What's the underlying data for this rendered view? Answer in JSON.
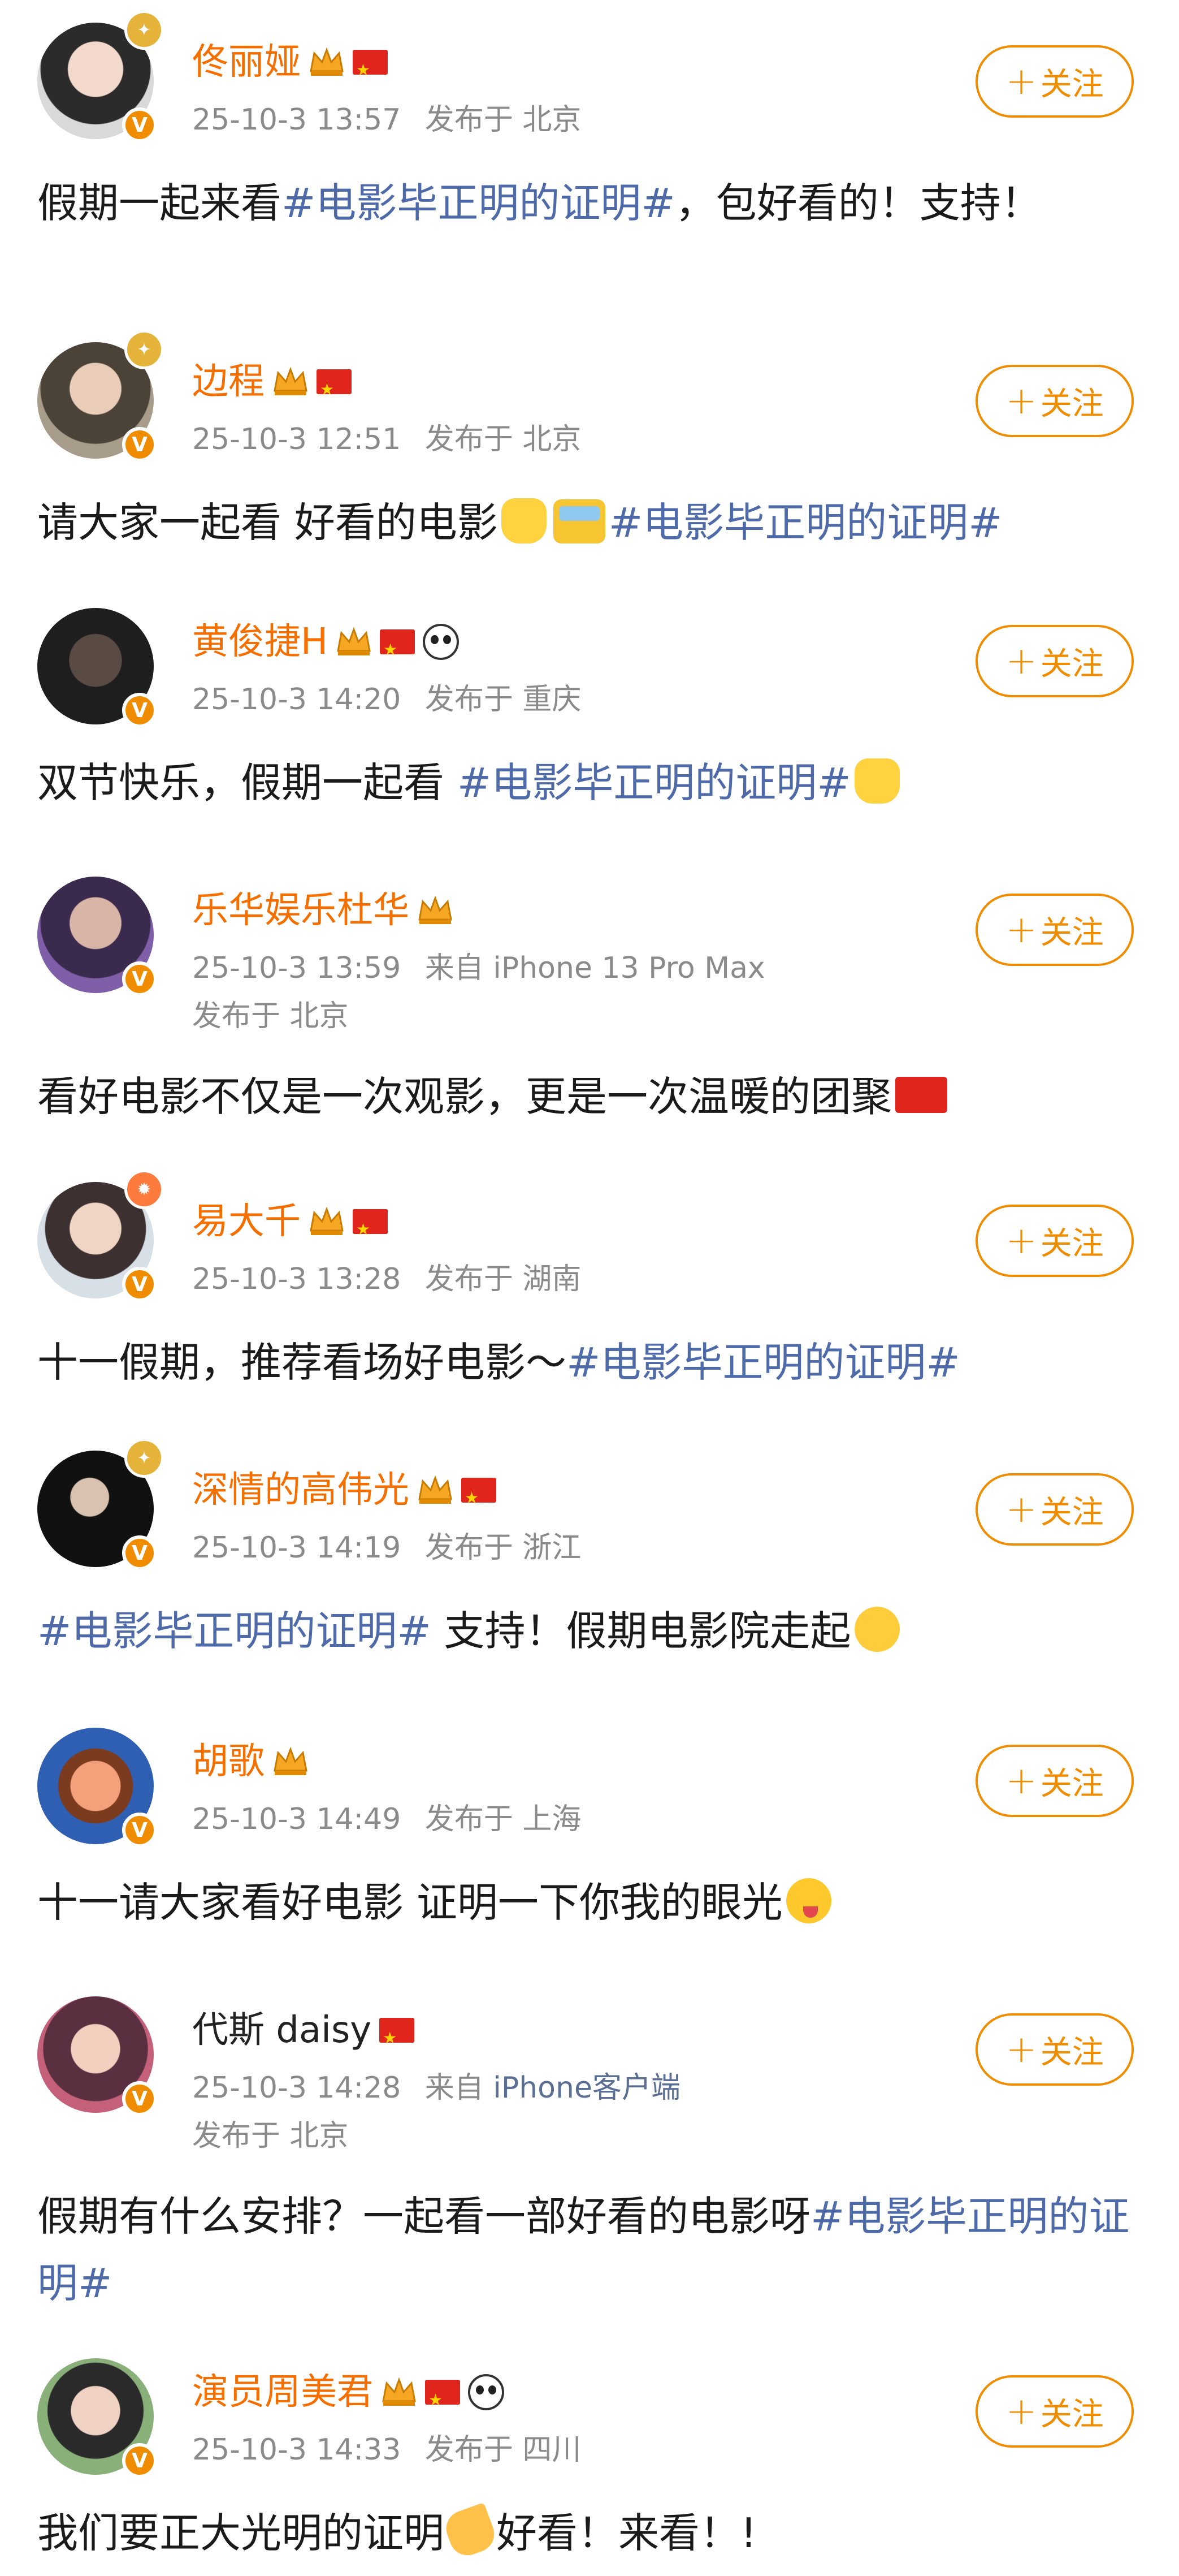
{
  "follow_label": "关注",
  "follow_plus": "+",
  "published_prefix": "发布于",
  "from_prefix": "来自",
  "accent_color": "#f08c00",
  "topic_color": "#4e6aa8",
  "posts": [
    {
      "name": "佟丽娅",
      "time": "25-10-3 13:57",
      "location": "北京",
      "text": [
        "假期一起来看",
        "#电影毕正明的证明#",
        "，包好看的！支持！"
      ],
      "badges": [
        "crown-icon",
        "china-flag-icon"
      ]
    },
    {
      "name": "边程",
      "time": "25-10-3 12:51",
      "location": "北京",
      "text": [
        "请大家一起看 好看的电影",
        "#电影毕正明的证明#"
      ],
      "badges": [
        "crown-icon",
        "china-flag-icon"
      ]
    },
    {
      "name": "黄俊捷H",
      "time": "25-10-3 14:20",
      "location": "重庆",
      "text": [
        "双节快乐，假期一起看 ",
        "#电影毕正明的证明#"
      ],
      "badges": [
        "crown-icon",
        "china-flag-icon",
        "panda-icon"
      ]
    },
    {
      "name": "乐华娱乐杜华",
      "time": "25-10-3 13:59",
      "device": "iPhone 13 Pro Max",
      "location": "北京",
      "text": [
        "看好电影不仅是一次观影，更是一次温暖的团聚"
      ],
      "badges": [
        "crown-icon"
      ]
    },
    {
      "name": "易大千",
      "time": "25-10-3 13:28",
      "location": "湖南",
      "text": [
        "十一假期，推荐看场好电影～",
        "#电影毕正明的证明#"
      ],
      "badges": [
        "crown-icon",
        "china-flag-icon"
      ]
    },
    {
      "name": "深情的高伟光",
      "time": "25-10-3 14:19",
      "location": "浙江",
      "text": [
        "#电影毕正明的证明#",
        " 支持！假期电影院走起"
      ],
      "badges": [
        "crown-icon",
        "china-flag-icon"
      ]
    },
    {
      "name": "胡歌",
      "time": "25-10-3 14:49",
      "location": "上海",
      "text": [
        "十一请大家看好电影 证明一下你我的眼光"
      ],
      "badges": [
        "crown-icon"
      ]
    },
    {
      "name": "代斯 daisy",
      "time": "25-10-3 14:28",
      "device": "iPhone客户端",
      "location": "北京",
      "text": [
        "假期有什么安排？一起看一部好看的电影呀",
        "#电影毕正明的证明#"
      ],
      "badges": [
        "china-flag-icon"
      ]
    },
    {
      "name": "演员周美君",
      "time": "25-10-3 14:33",
      "location": "四川",
      "text": [
        "我们要正大光明的证明",
        "好看！来看！!"
      ],
      "badges": [
        "crown-icon",
        "china-flag-icon",
        "panda-icon"
      ]
    }
  ]
}
